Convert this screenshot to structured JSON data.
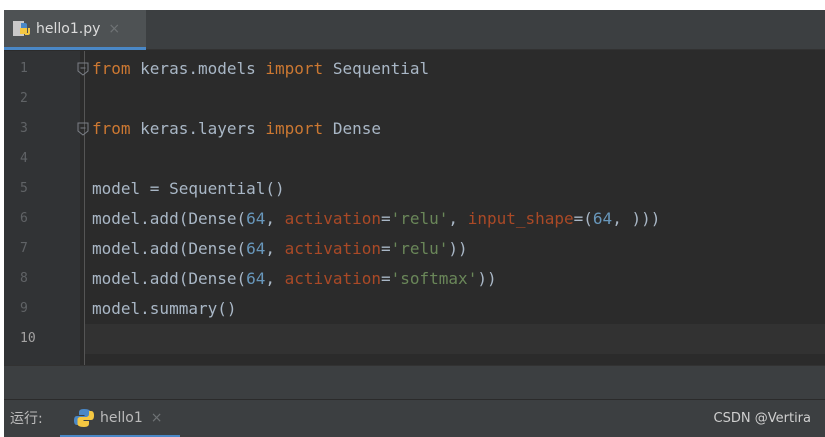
{
  "editor_tab": {
    "file_name": "hello1.py",
    "close_glyph": "×",
    "icon": "python-file-icon"
  },
  "editor": {
    "active_line": "10",
    "lines": [
      {
        "number": "1",
        "tokens": [
          {
            "t": "from",
            "c": "kw"
          },
          {
            "t": " keras.models ",
            "c": ""
          },
          {
            "t": "import",
            "c": "kw"
          },
          {
            "t": " Sequential",
            "c": ""
          }
        ]
      },
      {
        "number": "2",
        "tokens": []
      },
      {
        "number": "3",
        "tokens": [
          {
            "t": "from",
            "c": "kw"
          },
          {
            "t": " keras.layers ",
            "c": ""
          },
          {
            "t": "import",
            "c": "kw"
          },
          {
            "t": " Dense",
            "c": ""
          }
        ]
      },
      {
        "number": "4",
        "tokens": []
      },
      {
        "number": "5",
        "tokens": [
          {
            "t": "model = Sequential()",
            "c": ""
          }
        ]
      },
      {
        "number": "6",
        "tokens": [
          {
            "t": "model.add(Dense(",
            "c": ""
          },
          {
            "t": "64",
            "c": "num"
          },
          {
            "t": ", ",
            "c": ""
          },
          {
            "t": "activation",
            "c": "kwarg"
          },
          {
            "t": "=",
            "c": ""
          },
          {
            "t": "'relu'",
            "c": "str"
          },
          {
            "t": ", ",
            "c": ""
          },
          {
            "t": "input_shape",
            "c": "kwarg"
          },
          {
            "t": "=(",
            "c": ""
          },
          {
            "t": "64",
            "c": "num"
          },
          {
            "t": ", )))",
            "c": ""
          }
        ]
      },
      {
        "number": "7",
        "tokens": [
          {
            "t": "model.add(Dense(",
            "c": ""
          },
          {
            "t": "64",
            "c": "num"
          },
          {
            "t": ", ",
            "c": ""
          },
          {
            "t": "activation",
            "c": "kwarg"
          },
          {
            "t": "=",
            "c": ""
          },
          {
            "t": "'relu'",
            "c": "str"
          },
          {
            "t": "))",
            "c": ""
          }
        ]
      },
      {
        "number": "8",
        "tokens": [
          {
            "t": "model.add(Dense(",
            "c": ""
          },
          {
            "t": "64",
            "c": "num"
          },
          {
            "t": ", ",
            "c": ""
          },
          {
            "t": "activation",
            "c": "kwarg"
          },
          {
            "t": "=",
            "c": ""
          },
          {
            "t": "'softmax'",
            "c": "str"
          },
          {
            "t": "))",
            "c": ""
          }
        ]
      },
      {
        "number": "9",
        "tokens": [
          {
            "t": "model.summary()",
            "c": ""
          }
        ]
      },
      {
        "number": "10",
        "tokens": []
      }
    ]
  },
  "run_bar": {
    "label": "运行:",
    "tab_name": "hello1",
    "close_glyph": "×",
    "icon": "python-icon"
  },
  "watermark": "CSDN @Vertira",
  "colors": {
    "background": "#2b2b2b",
    "keyword": "#cc7832",
    "number": "#6897bb",
    "keyword_argument": "#aa4926",
    "string": "#6a8759",
    "default_text": "#a9b7c6"
  }
}
